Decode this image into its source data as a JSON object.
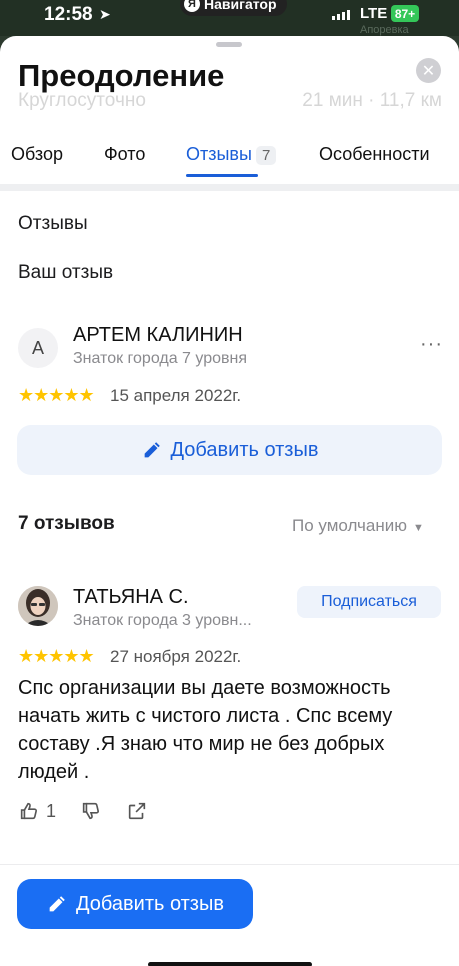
{
  "status_bar": {
    "time": "12:58",
    "nav_app": "Навигатор",
    "network": "LTE",
    "battery": "87+",
    "map_label": "Апоревка"
  },
  "sheet": {
    "title": "Преодоление",
    "ghost_left": "Круглосуточно",
    "ghost_right": "21 мин · 11,7 км",
    "tabs": [
      {
        "label": "Обзор"
      },
      {
        "label": "Фото"
      },
      {
        "label": "Отзывы",
        "count": "7"
      },
      {
        "label": "Особенности"
      }
    ]
  },
  "reviews_section": {
    "title": "Отзывы",
    "your_review_title": "Ваш отзыв"
  },
  "own_review": {
    "avatar_letter": "А",
    "name": "АРТЕМ КАЛИНИН",
    "level": "Знаток города 7 уровня",
    "rating": 5,
    "stars": "★★★★★",
    "date": "15 апреля 2022г.",
    "more": "···",
    "add_button": "Добавить отзыв"
  },
  "list_header": {
    "count_label": "7 отзывов",
    "sort_label": "По умолчанию"
  },
  "review": {
    "name": "ТАТЬЯНА С.",
    "level": "Знаток города 3 уровн...",
    "subscribe": "Подписаться",
    "rating": 5,
    "stars": "★★★★★",
    "date": "27 ноября 2022г.",
    "text": "Спс организации вы даете возможность начать жить с чистого листа . Спс всему составу .Я знаю что мир не без добрых людей .",
    "likes": "1"
  },
  "footer": {
    "add_button": "Добавить отзыв"
  },
  "icons": [
    "location-arrow-icon",
    "close-icon",
    "more-icon",
    "star-icon",
    "pencil-icon",
    "chevron-down-icon",
    "thumbs-up-icon",
    "thumbs-down-icon",
    "share-icon"
  ],
  "colors": {
    "accent": "#1a5ed8",
    "primary_button": "#1a6ef3",
    "star": "#ffc400",
    "battery": "#34c759"
  }
}
